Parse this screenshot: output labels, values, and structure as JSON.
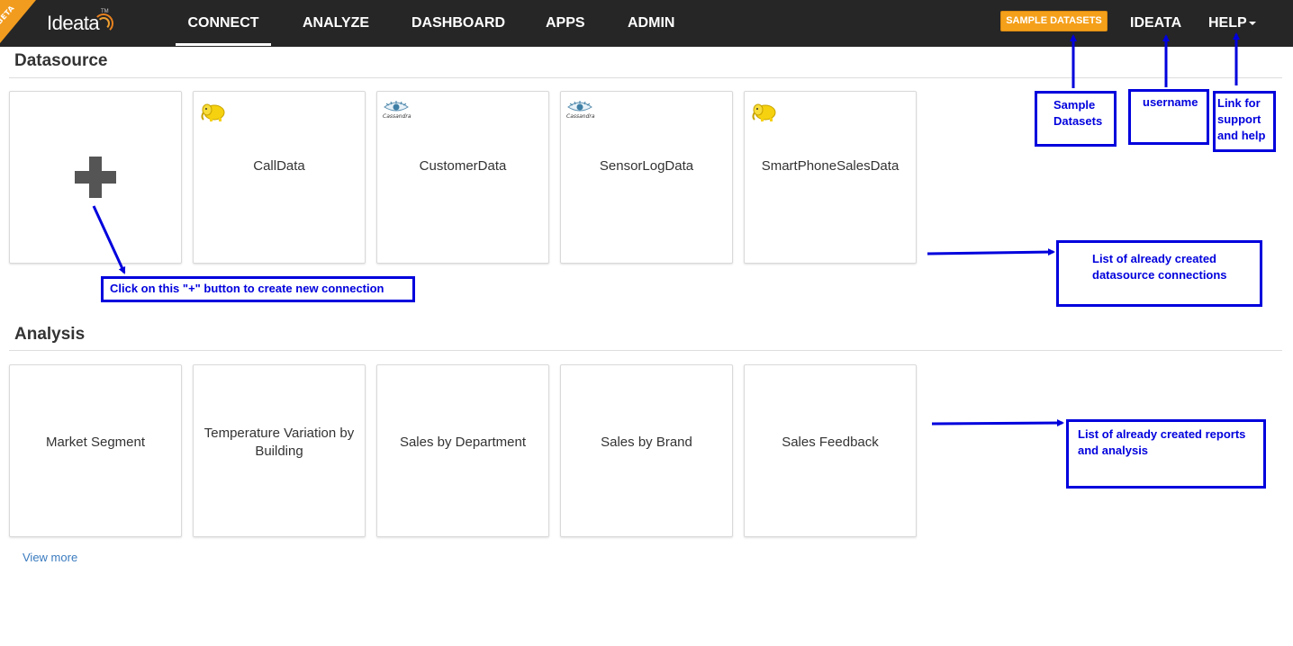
{
  "nav": {
    "beta_label": "BETA",
    "logo_text": "Ideata",
    "logo_tm": "TM",
    "items": [
      {
        "label": "CONNECT",
        "active": true
      },
      {
        "label": "ANALYZE"
      },
      {
        "label": "DASHBOARD"
      },
      {
        "label": "APPS"
      },
      {
        "label": "ADMIN"
      }
    ],
    "sample_datasets_label": "SAMPLE DATASETS",
    "username": "IDEATA",
    "help_label": "HELP",
    "accent_color": "#f5a01a"
  },
  "datasource": {
    "title": "Datasource",
    "cards": [
      {
        "label": "",
        "icon": "plus-icon"
      },
      {
        "label": "CallData",
        "icon": "hadoop-elephant-icon"
      },
      {
        "label": "CustomerData",
        "icon": "cassandra-eye-icon"
      },
      {
        "label": "SensorLogData",
        "icon": "cassandra-eye-icon"
      },
      {
        "label": "SmartPhoneSalesData",
        "icon": "hadoop-elephant-icon"
      }
    ],
    "cassandra_word": "Cassandra"
  },
  "analysis": {
    "title": "Analysis",
    "cards": [
      {
        "label": "Market Segment"
      },
      {
        "label": "Temperature Variation by Building"
      },
      {
        "label": "Sales by Department"
      },
      {
        "label": "Sales by Brand"
      },
      {
        "label": "Sales Feedback"
      }
    ],
    "view_more": "View more"
  },
  "annotations": {
    "sample_datasets": "Sample Datasets",
    "username": "username",
    "help": "Link for support and help",
    "plus": "Click on this \"+\" button to create new connection",
    "datasource_list": "List of already created datasource connections",
    "analysis_list": "List of already created reports and analysis",
    "color": "#0000dd"
  }
}
